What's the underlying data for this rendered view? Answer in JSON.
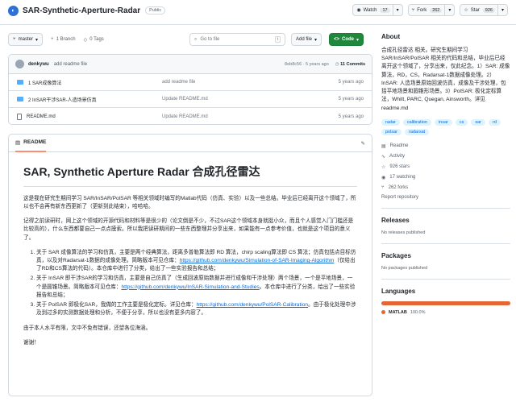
{
  "header": {
    "repo_name": "SAR-Synthetic-Aperture-Radar",
    "visibility": "Public",
    "watch_label": "Watch",
    "watch_count": "17",
    "fork_label": "Fork",
    "fork_count": "262",
    "star_label": "Star",
    "star_count": "926"
  },
  "toolbar": {
    "branch": "master",
    "branches": "1 Branch",
    "tags": "0 Tags",
    "search_placeholder": "Go to file",
    "search_kbd": "t",
    "add_file": "Add file",
    "code": "Code"
  },
  "commit": {
    "author": "denkywu",
    "message": "add readme file",
    "hash_time": "8eb8c56 · 5 years ago",
    "commits": "11 Commits"
  },
  "files": [
    {
      "name": "1 SAR成像算法",
      "message": "add readme file",
      "date": "5 years ago",
      "type": "folder"
    },
    {
      "name": "2 InSAR干涉SAR-人造场景仿真",
      "message": "Update README.md",
      "date": "5 years ago",
      "type": "folder"
    },
    {
      "name": "README.md",
      "message": "Update README.md",
      "date": "5 years ago",
      "type": "file"
    }
  ],
  "readme": {
    "tab": "README",
    "title": "SAR, Synthetic Aperture Radar 合成孔径雷达",
    "p1": "这是我在研究生期间学习 SAR/InSAR/PolSAR 等相关领域时编写的Matlab代码（仿真、实验）以及一些总结。毕业后已经离开这个领域了，所以也不会再有新东西更新了（更新到此结束），哈哈哈。",
    "p2": "记得之前读研时，网上这个领域的开源代码和材料等是很少的（论文倒是不少，不过SAR这个领域本身就挺小众，而且个人感觉入门门槛还是比较高的），什么东西都要自己一点点摸索。所以我把读研期间的一些东西整理并分享出来，如果能有一点参考价值，也就是这个项目的意义了。",
    "li1_text": "关于 SAR 成像算法的学习和仿真，主要是两个经典算法，距离多普勒算法即 RD 算法，chirp scaling算法即 CS 算法；仿真包括点目标仿真，以及对Radarsat-1数据的成像处理。简略版本可见仓库：",
    "li1_link": "https://github.com/denkywu/Simulation-of-SAR-Imaging-Algorithm",
    "li1_after": "（仅给出了RD和CS算法的代码）。本仓库中进行了分类，给出了一些实验报告和总结；",
    "li2_text": "关于 InSAR 即干涉SAR的学习和仿真，主要是自己仿真了（生成回波原始数据并进行成像和干涉处理）两个场景，一个是平地场景，一个是圆锥场景。简略版本可见仓库：",
    "li2_link": "https://github.com/denkywu/InSAR-Simulation-and-Studies",
    "li2_after": "。本仓库中进行了分类，给出了一些实验报告和总结；",
    "li3_text": "关于 PolSAR 即极化SAR，我做的工作主要是极化定标。详见仓库：",
    "li3_link": "https://github.com/denkywu/PolSAR-Calibration",
    "li3_after": "。由于极化处理中涉及到过多的实测数据处理和分析，不便于分享，所以也没有更多内容了。",
    "p3": "由于本人水平有限，文中不免有错误，还望各位海涵。",
    "p4": "谢谢！"
  },
  "about": {
    "heading": "About",
    "description": "合成孔径雷达 相关。研究生期间学习SAR/InSAR/PolSAR 相关的代码和总结，毕业后已经离开这个领域了，分享出来，仅此纪念。1）SAR: 成像算法，RD，CS，Radarsat-1数据成像处理。2）InSAR: 人造场景原始回波仿真，成像及干涉处理，包括平地场景和圆锥形场景。3）PolSAR: 极化定标算法，Whitt, PARC, Quegan, Ainsworth。详见 readme.md",
    "topics": [
      "radar",
      "calibration",
      "insar",
      "cs",
      "sar",
      "rd",
      "polsar",
      "radarsat"
    ],
    "readme_link": "Readme",
    "activity": "Activity",
    "stars": "926 stars",
    "watching": "17 watching",
    "forks": "262 forks",
    "report": "Report repository"
  },
  "releases": {
    "heading": "Releases",
    "text": "No releases published"
  },
  "packages": {
    "heading": "Packages",
    "text": "No packages published"
  },
  "languages": {
    "heading": "Languages",
    "name": "MATLAB",
    "percent": "100.0%",
    "color": "#e16737"
  }
}
